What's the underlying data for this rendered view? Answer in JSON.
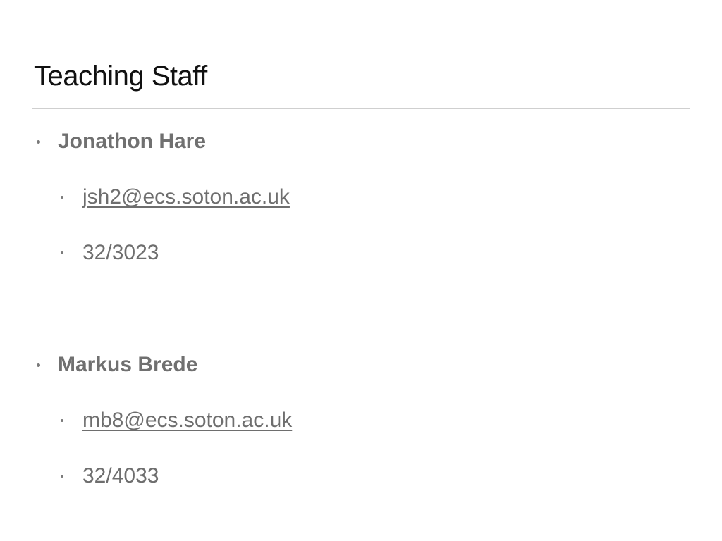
{
  "slide": {
    "title": "Teaching Staff",
    "staff": [
      {
        "name": "Jonathon Hare",
        "email": "jsh2@ecs.soton.ac.uk",
        "room": "32/3023"
      },
      {
        "name": "Markus Brede",
        "email": "mb8@ecs.soton.ac.uk",
        "room": "32/4033"
      }
    ]
  },
  "colors": {
    "title": "#111111",
    "body_text": "#707070",
    "rule": "#cfcfcf",
    "background": "#ffffff"
  }
}
